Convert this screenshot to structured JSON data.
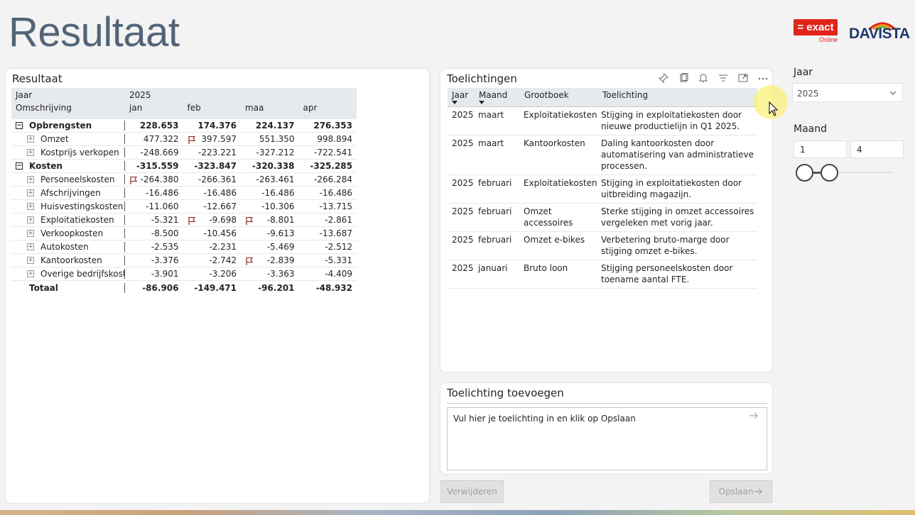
{
  "page_title": "Resultaat",
  "logos": {
    "exact": {
      "main": "= exact",
      "sub": "Online"
    },
    "davista": "DAVISTA"
  },
  "resultaat": {
    "title": "Resultaat",
    "header": {
      "row1_label": "Jaar",
      "year": "2025",
      "row2_label": "Omschrijving",
      "months": [
        "jan",
        "feb",
        "maa",
        "apr"
      ]
    },
    "rows": [
      {
        "label": "Opbrengsten",
        "type": "group",
        "values": [
          "228.653",
          "174.376",
          "224.137",
          "276.353"
        ]
      },
      {
        "label": "Omzet",
        "type": "child",
        "values": [
          "477.322",
          "397.597",
          "551.350",
          "998.894"
        ]
      },
      {
        "label": "Kostprijs verkopen",
        "type": "child",
        "values": [
          "-248.669",
          "-223.221",
          "-327.212",
          "-722.541"
        ]
      },
      {
        "label": "Kosten",
        "type": "group",
        "values": [
          "-315.559",
          "-323.847",
          "-320.338",
          "-325.285"
        ]
      },
      {
        "label": "Personeelskosten",
        "type": "child",
        "values": [
          "-264.380",
          "-266.361",
          "-263.461",
          "-266.284"
        ]
      },
      {
        "label": "Afschrijvingen",
        "type": "child",
        "values": [
          "-16.486",
          "-16.486",
          "-16.486",
          "-16.486"
        ]
      },
      {
        "label": "Huisvestingskosten",
        "type": "child",
        "values": [
          "-11.060",
          "-12.667",
          "-10.306",
          "-13.715"
        ]
      },
      {
        "label": "Exploitatiekosten",
        "type": "child",
        "values": [
          "-5.321",
          "-9.698",
          "-8.801",
          "-2.861"
        ]
      },
      {
        "label": "Verkoopkosten",
        "type": "child",
        "values": [
          "-8.500",
          "-10.456",
          "-9.613",
          "-13.687"
        ]
      },
      {
        "label": "Autokosten",
        "type": "child",
        "values": [
          "-2.535",
          "-2.231",
          "-5.469",
          "-2.512"
        ]
      },
      {
        "label": "Kantoorkosten",
        "type": "child",
        "values": [
          "-3.376",
          "-2.742",
          "-2.839",
          "-5.331"
        ]
      },
      {
        "label": "Overige bedrijfskost...",
        "type": "child",
        "values": [
          "-3.901",
          "-3.206",
          "-3.363",
          "-4.409"
        ]
      },
      {
        "label": "Totaal",
        "type": "total",
        "values": [
          "-86.906",
          "-149.471",
          "-96.201",
          "-48.932"
        ]
      }
    ]
  },
  "toelichtingen": {
    "title": "Toelichtingen",
    "columns": [
      "Jaar",
      "Maand",
      "Grootboek",
      "Toelichting"
    ],
    "rows": [
      {
        "jaar": "2025",
        "maand": "maart",
        "grootboek": "Exploitatiekosten",
        "toelichting": "Stijging in exploitatiekosten door nieuwe productielijn in Q1 2025."
      },
      {
        "jaar": "2025",
        "maand": "maart",
        "grootboek": "Kantoorkosten",
        "toelichting": "Daling kantoorkosten door automatisering van administratieve processen."
      },
      {
        "jaar": "2025",
        "maand": "februari",
        "grootboek": "Exploitatiekosten",
        "toelichting": "Stijging in exploitatiekosten door uitbreiding magazijn."
      },
      {
        "jaar": "2025",
        "maand": "februari",
        "grootboek": "Omzet accessoires",
        "toelichting": "Sterke stijging in omzet accessoires vergeleken met vorig jaar."
      },
      {
        "jaar": "2025",
        "maand": "februari",
        "grootboek": "Omzet e-bikes",
        "toelichting": "Verbetering bruto-marge door stijging omzet e-bikes."
      },
      {
        "jaar": "2025",
        "maand": "januari",
        "grootboek": "Bruto loon",
        "toelichting": "Stijging personeelskosten door toename aantal FTE."
      }
    ]
  },
  "toevoegen": {
    "title": "Toelichting toevoegen",
    "placeholder": "Vul hier je toelichting in en klik op Opslaan"
  },
  "buttons": {
    "delete": "Verwijderen",
    "save": "Opslaan"
  },
  "slicers": {
    "jaar_label": "Jaar",
    "jaar_value": "2025",
    "maand_label": "Maand",
    "maand_min": "1",
    "maand_max": "4"
  }
}
